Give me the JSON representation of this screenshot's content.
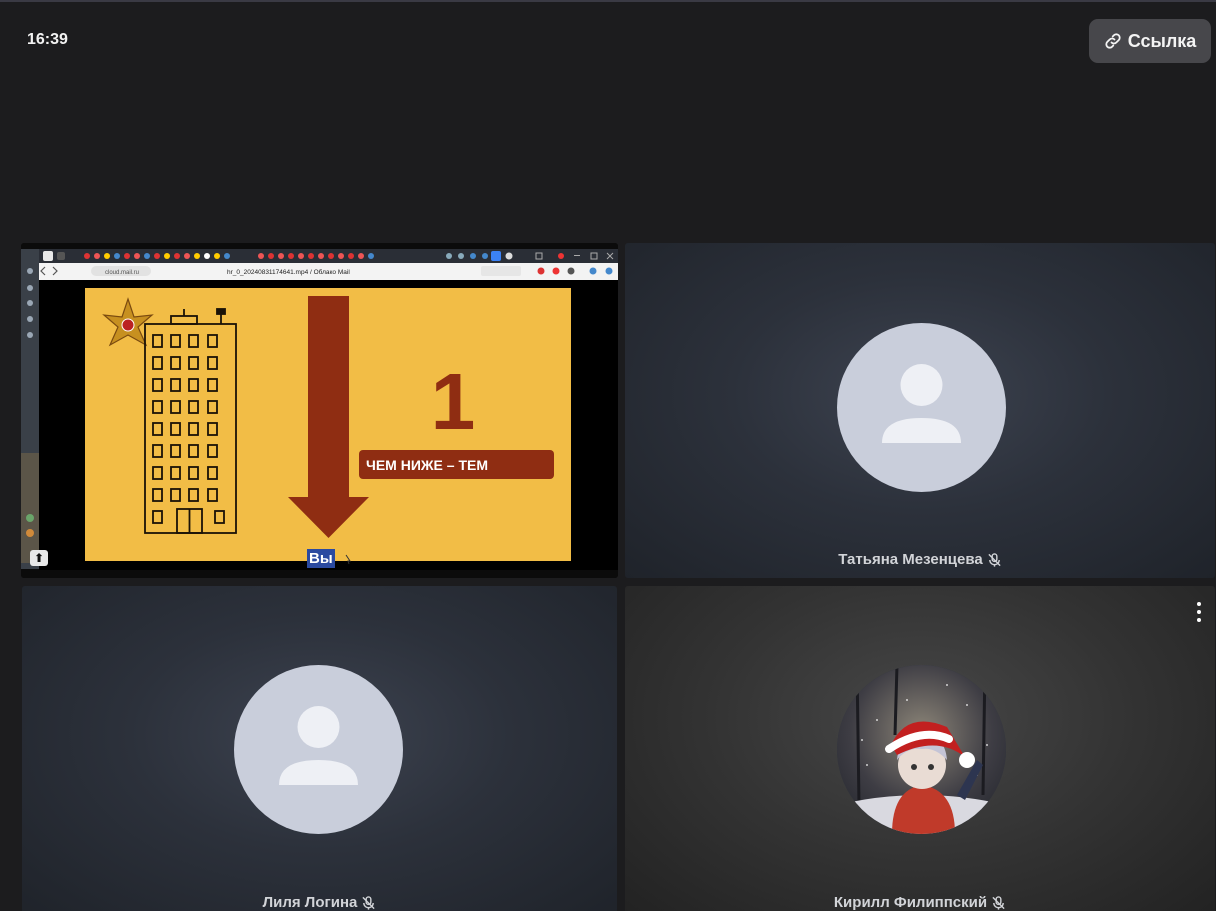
{
  "clock": "16:39",
  "link_button": {
    "label": "Ссылка",
    "icon": "link-icon"
  },
  "screen_share": {
    "tab_title": "hr_0_20240831174641.mp4 / Облако Mail",
    "url": "cloud.mail.ru",
    "slide_number": "1",
    "slide_banner": "ЧЕМ НИЖЕ – ТЕМ",
    "colors": {
      "slide_bg": "#f2bd46",
      "arrow": "#8f2d12"
    }
  },
  "participants": [
    {
      "name": "Вы",
      "muted": false
    },
    {
      "name": "Татьяна Мезенцева",
      "muted": true,
      "avatar": "default-user-icon"
    },
    {
      "name": "Лиля Логина",
      "muted": true,
      "avatar": "default-user-icon"
    },
    {
      "name": "Кирилл Филиппский",
      "muted": true,
      "avatar": "photo-avatar"
    }
  ]
}
